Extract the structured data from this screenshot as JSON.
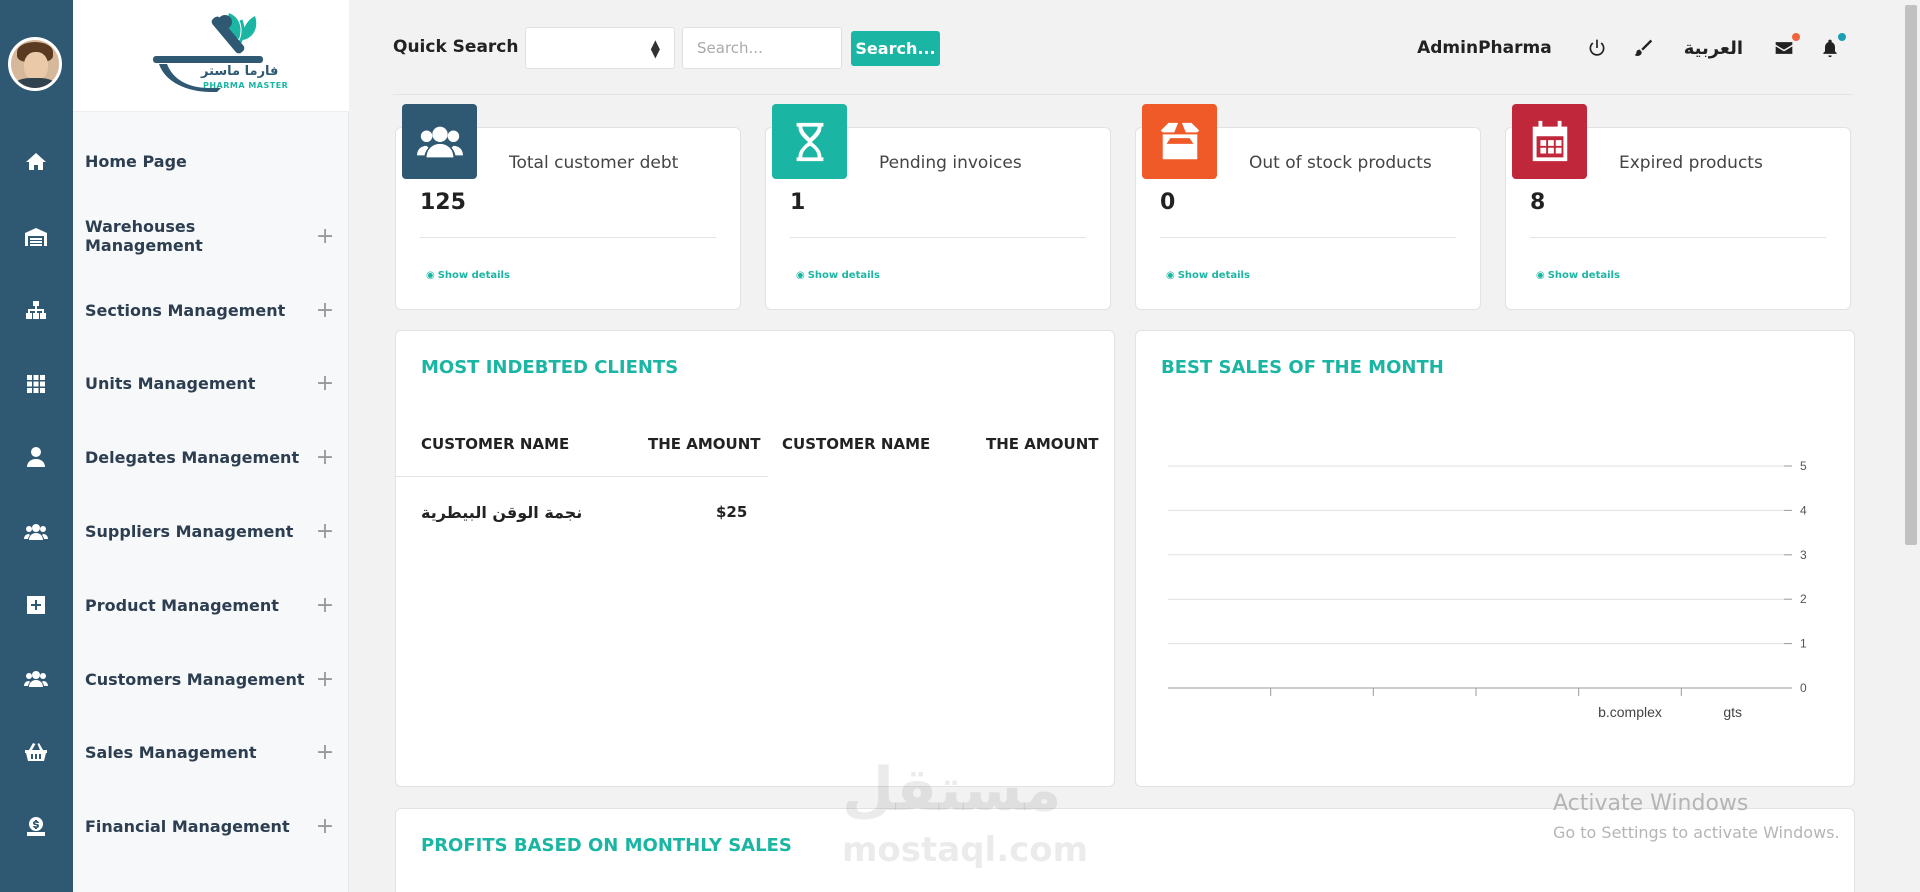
{
  "brand": {
    "name_ar": "فارما ماستر",
    "name_en": "PHARMA MASTER"
  },
  "sidebar": {
    "items": [
      {
        "label": "Home Page",
        "icon": "home-icon",
        "expandable": false
      },
      {
        "label": "Warehouses Management",
        "icon": "warehouse-icon",
        "expandable": true
      },
      {
        "label": "Sections Management",
        "icon": "sitemap-icon",
        "expandable": true
      },
      {
        "label": "Units Management",
        "icon": "grid-icon",
        "expandable": true
      },
      {
        "label": "Delegates Management",
        "icon": "user-tie-icon",
        "expandable": true
      },
      {
        "label": "Suppliers Management",
        "icon": "users-icon",
        "expandable": true
      },
      {
        "label": "Product Management",
        "icon": "plus-square-icon",
        "expandable": true
      },
      {
        "label": "Customers Management",
        "icon": "users-icon",
        "expandable": true
      },
      {
        "label": "Sales Management",
        "icon": "basket-icon",
        "expandable": true
      },
      {
        "label": "Financial Management",
        "icon": "money-bag-icon",
        "expandable": true
      }
    ],
    "expand_symbol": "+"
  },
  "topbar": {
    "quick_search_label": "Quick Search",
    "search_placeholder": "Search...",
    "search_button": "Search...",
    "username": "AdminPharma",
    "language_label": "العربية",
    "mail_dot_color": "#f0643c",
    "bell_dot_color": "#1b9fb5"
  },
  "stats": [
    {
      "title": "Total customer debt",
      "value": "125",
      "details": "Show details",
      "color": "#2f5873",
      "icon": "users-icon"
    },
    {
      "title": "Pending invoices",
      "value": "1",
      "details": "Show details",
      "color": "#1bb5a3",
      "icon": "hourglass-icon"
    },
    {
      "title": "Out of stock products",
      "value": "0",
      "details": "Show details",
      "color": "#f05a28",
      "icon": "box-icon"
    },
    {
      "title": "Expired products",
      "value": "8",
      "details": "Show details",
      "color": "#c0273a",
      "icon": "calendar-icon"
    }
  ],
  "indebted": {
    "title": "MOST INDEBTED CLIENTS",
    "headers": [
      "CUSTOMER NAME",
      "THE AMOUNT",
      "CUSTOMER NAME",
      "THE AMOUNT"
    ],
    "rows": [
      {
        "name": "نجمة الوقن البيطرية",
        "amount": "$25"
      }
    ]
  },
  "best_sales": {
    "title": "BEST SALES OF THE MONTH"
  },
  "chart_data": {
    "type": "bar",
    "categories": [
      "",
      "",
      "",
      "",
      "b.complex",
      "gts"
    ],
    "values": [
      0,
      0,
      0,
      0,
      0,
      0
    ],
    "ylim": [
      0,
      5
    ],
    "yticks": [
      "0",
      "1",
      "2",
      "3",
      "4",
      "5"
    ],
    "y_axis_side": "right",
    "grid": true
  },
  "profits": {
    "title": "PROFITS BASED ON MONTHLY SALES"
  },
  "watermarks": {
    "activate_title": "Activate Windows",
    "activate_sub": "Go to Settings to activate Windows.",
    "brand_ar": "مستقل",
    "brand_en": "mostaql.com"
  }
}
